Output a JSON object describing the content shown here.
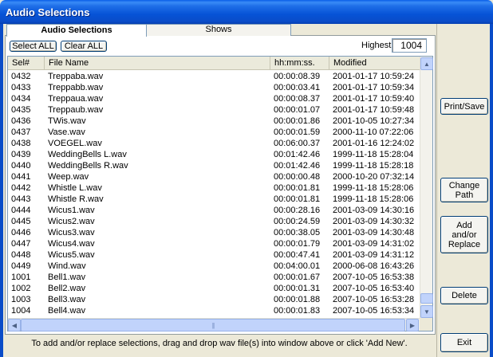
{
  "window": {
    "title": "Audio Selections"
  },
  "tabs": [
    {
      "label": "Audio Selections"
    },
    {
      "label": "Shows"
    }
  ],
  "toolbar": {
    "select_all": "Select ALL",
    "clear_all": "Clear ALL",
    "highest_label": "Highest",
    "highest_value": "1004"
  },
  "columns": [
    "Sel#",
    "File Name",
    "hh:mm:ss.",
    "Modified"
  ],
  "rows": [
    [
      "0432",
      "Treppaba.wav",
      "00:00:08.39",
      "2001-01-17 10:59:24"
    ],
    [
      "0433",
      "Treppabb.wav",
      "00:00:03.41",
      "2001-01-17 10:59:34"
    ],
    [
      "0434",
      "Treppaua.wav",
      "00:00:08.37",
      "2001-01-17 10:59:40"
    ],
    [
      "0435",
      "Treppaub.wav",
      "00:00:01.07",
      "2001-01-17 10:59:48"
    ],
    [
      "0436",
      "TWis.wav",
      "00:00:01.86",
      "2001-10-05 10:27:34"
    ],
    [
      "0437",
      "Vase.wav",
      "00:00:01.59",
      "2000-11-10 07:22:06"
    ],
    [
      "0438",
      "VOEGEL.wav",
      "00:06:00.37",
      "2001-01-16 12:24:02"
    ],
    [
      "0439",
      "WeddingBells L.wav",
      "00:01:42.46",
      "1999-11-18 15:28:04"
    ],
    [
      "0440",
      "WeddingBells R.wav",
      "00:01:42.46",
      "1999-11-18 15:28:18"
    ],
    [
      "0441",
      "Weep.wav",
      "00:00:00.48",
      "2000-10-20 07:32:14"
    ],
    [
      "0442",
      "Whistle L.wav",
      "00:00:01.81",
      "1999-11-18 15:28:06"
    ],
    [
      "0443",
      "Whistle R.wav",
      "00:00:01.81",
      "1999-11-18 15:28:06"
    ],
    [
      "0444",
      "Wicus1.wav",
      "00:00:28.16",
      "2001-03-09 14:30:16"
    ],
    [
      "0445",
      "Wicus2.wav",
      "00:00:24.59",
      "2001-03-09 14:30:32"
    ],
    [
      "0446",
      "Wicus3.wav",
      "00:00:38.05",
      "2001-03-09 14:30:48"
    ],
    [
      "0447",
      "Wicus4.wav",
      "00:00:01.79",
      "2001-03-09 14:31:02"
    ],
    [
      "0448",
      "Wicus5.wav",
      "00:00:47.41",
      "2001-03-09 14:31:12"
    ],
    [
      "0449",
      "Wind.wav",
      "00:04:00.01",
      "2000-06-08 16:43:26"
    ],
    [
      "1001",
      "Bell1.wav",
      "00:00:01.67",
      "2007-10-05 16:53:38"
    ],
    [
      "1002",
      "Bell2.wav",
      "00:00:01.31",
      "2007-10-05 16:53:40"
    ],
    [
      "1003",
      "Bell3.wav",
      "00:00:01.88",
      "2007-10-05 16:53:28"
    ],
    [
      "1004",
      "Bell4.wav",
      "00:00:01.83",
      "2007-10-05 16:53:34"
    ]
  ],
  "side_buttons": {
    "print_save": "Print/Save",
    "change_path": [
      "Change",
      "Path"
    ],
    "add_replace": [
      "Add",
      "and/or",
      "Replace"
    ],
    "delete": "Delete",
    "exit": "Exit"
  },
  "status": "To add and/or replace selections, drag and drop wav file(s) into window above or click 'Add New'."
}
